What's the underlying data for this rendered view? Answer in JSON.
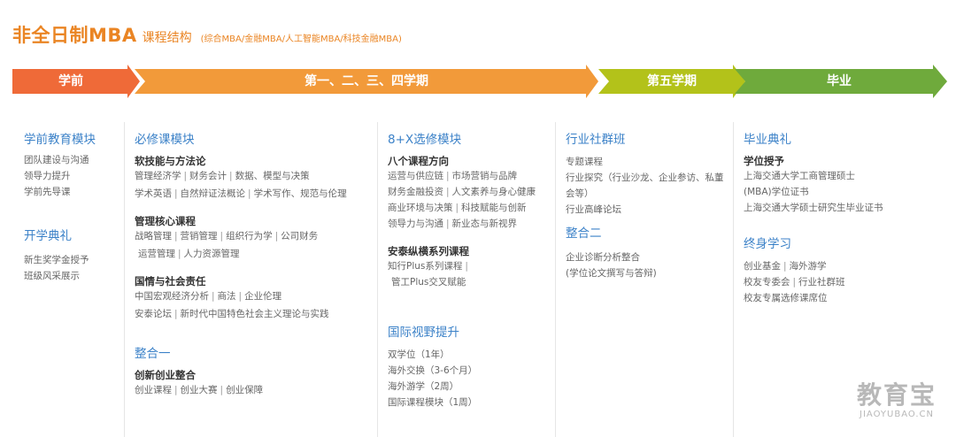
{
  "header": {
    "title": "非全日制MBA",
    "subtitle": "课程结构",
    "note": "(综合MBA/金融MBA/人工智能MBA/科技金融MBA)"
  },
  "timeline": [
    {
      "label": "学前",
      "color": "#ef6a38"
    },
    {
      "label": "第一、二、三、四学期",
      "color": "#f29a3a"
    },
    {
      "label": "第五学期",
      "color": "#b3c21a"
    },
    {
      "label": "毕业",
      "color": "#6faa3c"
    }
  ],
  "col1": {
    "m1": "学前教育模块",
    "m1_lines": [
      "团队建设与沟通",
      "领导力提升",
      "学前先导课"
    ],
    "m2": "开学典礼",
    "m2_lines": [
      "新生奖学金授予",
      "班级风采展示"
    ]
  },
  "col2": {
    "m1": "必修课模块",
    "s1": "软技能与方法论",
    "s1_l1": [
      "管理经济学",
      "财务会计",
      "数据、模型与决策"
    ],
    "s1_l2": [
      "学术英语",
      "自然辩证法概论",
      "学术写作、规范与伦理"
    ],
    "s2": "管理核心课程",
    "s2_l1": [
      "战略管理",
      "营销管理",
      "组织行为学",
      "公司财务"
    ],
    "s2_l2": [
      "运营管理",
      "人力资源管理"
    ],
    "s3": "国情与社会责任",
    "s3_l1": [
      "中国宏观经济分析",
      "商法",
      "企业伦理"
    ],
    "s3_l2": [
      "安泰论坛",
      "新时代中国特色社会主义理论与实践"
    ],
    "m2": "整合一",
    "s4": "创新创业整合",
    "s4_l1": [
      "创业课程",
      "创业大赛",
      "创业保障"
    ]
  },
  "col3": {
    "m1": "8+X选修模块",
    "s1": "八个课程方向",
    "s1_l1": [
      "运营与供应链",
      "市场营销与品牌"
    ],
    "s1_l2": [
      "财务金融投资",
      "人文素养与身心健康"
    ],
    "s1_l3": [
      "商业环境与决策",
      "科技赋能与创新"
    ],
    "s1_l4": [
      "领导力与沟通",
      "新业态与新视界"
    ],
    "s2": "安泰纵横系列课程",
    "s2_l1": [
      "知行Plus系列课程",
      ""
    ],
    "s2_l2": [
      "管工Plus交叉赋能"
    ],
    "m2": "国际视野提升",
    "m2_lines": [
      "双学位（1年）",
      "海外交换（3-6个月）",
      "海外游学（2周）",
      "国际课程模块（1周）"
    ]
  },
  "col4": {
    "m1": "行业社群班",
    "m1_lines": [
      "专题课程",
      "行业探究（行业沙龙、企业参访、私董",
      "会等）",
      "行业高峰论坛"
    ],
    "m2": "整合二",
    "m2_lines": [
      "企业诊断分析整合",
      "(学位论文撰写与答辩)"
    ]
  },
  "col5": {
    "m1": "毕业典礼",
    "s1": "学位授予",
    "s1_lines": [
      "上海交通大学工商管理硕士",
      "(MBA)学位证书",
      "上海交通大学硕士研究生毕业证书"
    ],
    "m2": "终身学习",
    "m2_l1": [
      "创业基金",
      "海外游学"
    ],
    "m2_l2": [
      "校友专委会",
      "行业社群班"
    ],
    "m2_l3": [
      "校友专属选修课席位"
    ]
  },
  "watermark": {
    "big": "教育宝",
    "small": "JIAOYUBAO.CN"
  }
}
